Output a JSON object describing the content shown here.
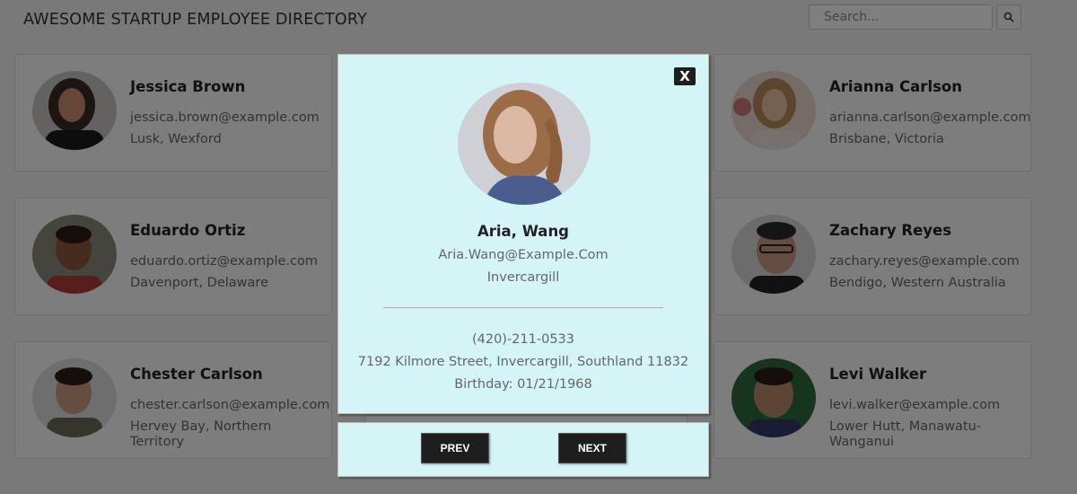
{
  "header": {
    "title": "AWESOME STARTUP EMPLOYEE DIRECTORY"
  },
  "search": {
    "placeholder": "Search...",
    "button_icon": "search-icon"
  },
  "employees": [
    {
      "name": "Jessica Brown",
      "email": "jessica.brown@example.com",
      "location": "Lusk, Wexford"
    },
    {
      "name": "Arianna Carlson",
      "email": "arianna.carlson@example.com",
      "location": "Brisbane, Victoria"
    },
    {
      "name": "Eduardo Ortiz",
      "email": "eduardo.ortiz@example.com",
      "location": "Davenport, Delaware"
    },
    {
      "name": "Zachary Reyes",
      "email": "zachary.reyes@example.com",
      "location": "Bendigo, Western Australia"
    },
    {
      "name": "Chester Carlson",
      "email": "chester.carlson@example.com",
      "location": "Hervey Bay, Northern Territory"
    },
    {
      "name": "Levi Walker",
      "email": "levi.walker@example.com",
      "location": "Lower Hutt, Manawatu-Wanganui"
    }
  ],
  "modal": {
    "close_label": "X",
    "name": "Aria, Wang",
    "email": "Aria.Wang@Example.Com",
    "city": "Invercargill",
    "phone": "(420)-211-0533",
    "address": "7192 Kilmore Street, Invercargill, Southland 11832",
    "birthday": "Birthday: 01/21/1968",
    "prev_label": "PREV",
    "next_label": "NEXT"
  },
  "colors": {
    "modal_bg": "#d4f4f5",
    "button_bg": "#1e1e1e",
    "overlay": "rgba(0,0,0,0.5)"
  }
}
